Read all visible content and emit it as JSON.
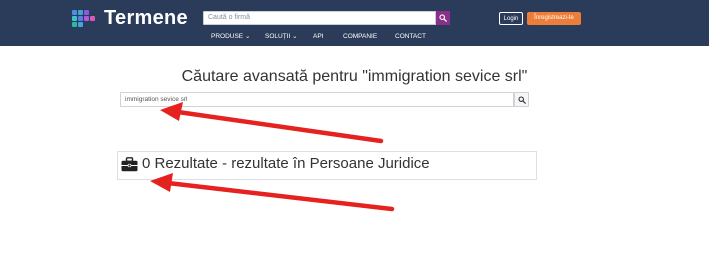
{
  "header": {
    "logo_text": "Termene",
    "search_placeholder": "Caută o firmă",
    "login_label": "Login",
    "register_label": "Înregistreazi-te",
    "nav": [
      "PRODUSE",
      "SOLUȚII",
      "API",
      "COMPANIE",
      "CONTACT"
    ],
    "colors": {
      "bar": "#2b3b5a",
      "search_button": "#8a2f8c",
      "register": "#ee7d3a"
    }
  },
  "main": {
    "title": "Căutare avansată pentru \"immigration sevice srl\"",
    "search_value": "immigration sevice srl",
    "results_text": "0 Rezultate - rezultate în Persoane Juridice"
  },
  "annotations": {
    "arrow_color": "#e5221f"
  }
}
